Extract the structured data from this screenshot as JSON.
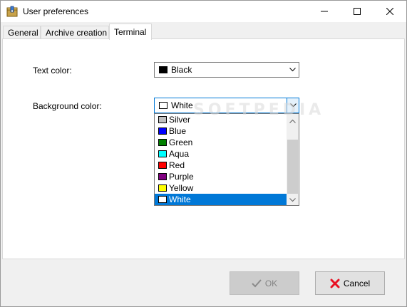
{
  "window": {
    "title": "User preferences",
    "controls": [
      "minimize-icon",
      "maximize-icon",
      "close-icon"
    ]
  },
  "tabs": [
    {
      "label": "General",
      "active": false
    },
    {
      "label": "Archive creation",
      "active": false
    },
    {
      "label": "Terminal",
      "active": true
    }
  ],
  "terminal": {
    "text_color": {
      "label": "Text color:",
      "value": "Black",
      "swatch": "#000000"
    },
    "background_color": {
      "label": "Background color:",
      "value": "White",
      "swatch": "#ffffff"
    }
  },
  "dropdown": {
    "items": [
      {
        "label": "Silver",
        "color": "#c0c0c0"
      },
      {
        "label": "Blue",
        "color": "#0000ff"
      },
      {
        "label": "Green",
        "color": "#008000"
      },
      {
        "label": "Aqua",
        "color": "#00ffff"
      },
      {
        "label": "Red",
        "color": "#ff0000"
      },
      {
        "label": "Purple",
        "color": "#800080"
      },
      {
        "label": "Yellow",
        "color": "#ffff00"
      },
      {
        "label": "White",
        "color": "#ffffff"
      }
    ],
    "selected": "White"
  },
  "watermark": "SOFTPEDIA",
  "buttons": {
    "ok": {
      "label": "OK",
      "enabled": false,
      "icon": "checkmark-icon"
    },
    "cancel": {
      "label": "Cancel",
      "enabled": true,
      "icon": "cancel-x-icon"
    }
  },
  "colors": {
    "accent": "#0078d7",
    "selection_bg": "#0078d7",
    "cancel_icon": "#e81123"
  }
}
